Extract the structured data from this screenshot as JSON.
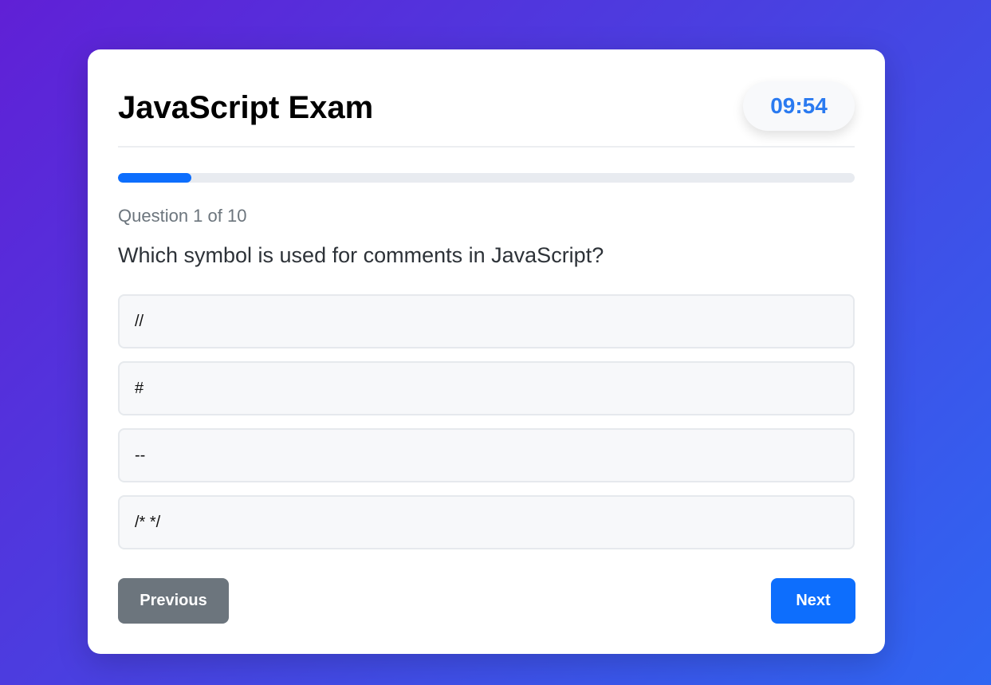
{
  "exam": {
    "title": "JavaScript Exam",
    "timer": "09:54"
  },
  "progress": {
    "current": 1,
    "total": 10,
    "fraction": 0.1,
    "label": "Question 1 of 10"
  },
  "question": {
    "text": "Which symbol is used for comments in JavaScript?",
    "options": [
      "//",
      "#",
      "--",
      "/* */"
    ]
  },
  "nav": {
    "previous_label": "Previous",
    "next_label": "Next"
  },
  "colors": {
    "accent": "#0d6efd",
    "secondary": "#6c757d",
    "timer_text": "#2a7af0"
  }
}
